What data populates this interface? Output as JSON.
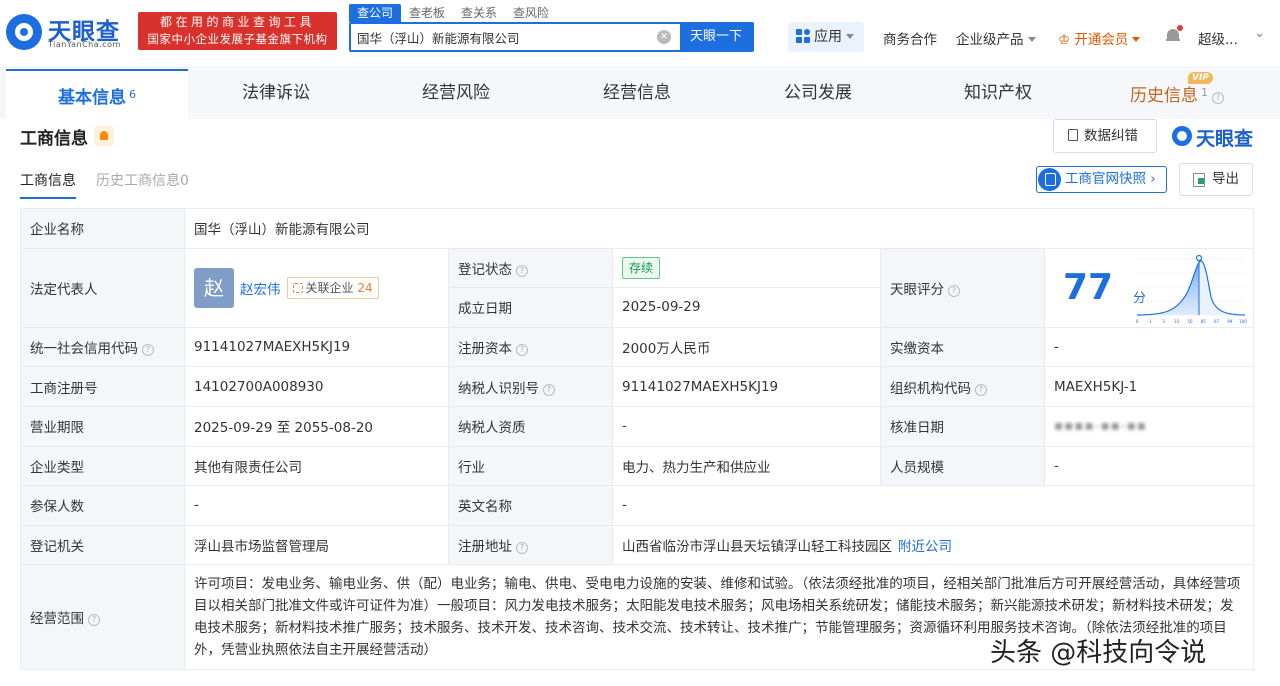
{
  "logo": {
    "title": "天眼查",
    "subtitle": "TianYanCha.com"
  },
  "slogan": {
    "line1": "都在用的商业查询工具",
    "line2": "国家中小企业发展子基金旗下机构"
  },
  "search": {
    "tabs": [
      "查公司",
      "查老板",
      "查关系",
      "查风险"
    ],
    "value": "国华（浮山）新能源有限公司",
    "button": "天眼一下"
  },
  "nav": {
    "apps": "应用",
    "business": "商务合作",
    "enterprise": "企业级产品",
    "vip": "开通会员",
    "user": "超级..."
  },
  "main_tabs": {
    "basic": "基本信息",
    "basic_count": "6",
    "legal": "法律诉讼",
    "risk": "经营风险",
    "operation": "经营信息",
    "development": "公司发展",
    "ip": "知识产权",
    "history": "历史信息",
    "history_count": "1",
    "vip_badge": "VIP"
  },
  "section": {
    "title": "工商信息",
    "correct": "数据纠错",
    "brand": "天眼查",
    "sub_tab_active": "工商信息",
    "sub_tab_history": "历史工商信息0",
    "snapshot": "工商官网快照",
    "export": "导出"
  },
  "table": {
    "company_name_label": "企业名称",
    "company_name": "国华（浮山）新能源有限公司",
    "legal_rep_label": "法定代表人",
    "legal_rep_avatar": "赵",
    "legal_rep": "赵宏伟",
    "related_label": "关联企业",
    "related_count": "24",
    "reg_status_label": "登记状态",
    "reg_status": "存续",
    "founded_label": "成立日期",
    "founded": "2025-09-29",
    "score_label": "天眼评分",
    "score": "77",
    "score_unit": "分",
    "credit_code_label": "统一社会信用代码",
    "credit_code": "91141027MAEXH5KJ19",
    "reg_capital_label": "注册资本",
    "reg_capital": "2000万人民币",
    "paid_capital_label": "实缴资本",
    "paid_capital": "-",
    "reg_no_label": "工商注册号",
    "reg_no": "14102700A008930",
    "tax_id_label": "纳税人识别号",
    "tax_id": "91141027MAEXH5KJ19",
    "org_code_label": "组织机构代码",
    "org_code": "MAEXH5KJ-1",
    "term_label": "营业期限",
    "term": "2025-09-29 至 2055-08-20",
    "tax_qual_label": "纳税人资质",
    "tax_qual": "-",
    "approval_label": "核准日期",
    "type_label": "企业类型",
    "type": "其他有限责任公司",
    "industry_label": "行业",
    "industry": "电力、热力生产和供应业",
    "staff_label": "人员规模",
    "staff": "-",
    "insured_label": "参保人数",
    "insured": "-",
    "english_label": "英文名称",
    "english": "-",
    "authority_label": "登记机关",
    "authority": "浮山县市场监督管理局",
    "address_label": "注册地址",
    "address": "山西省临汾市浮山县天坛镇浮山轻工科技园区",
    "nearby": "附近公司",
    "scope_label": "经营范围",
    "scope": "许可项目：发电业务、输电业务、供（配）电业务；输电、供电、受电电力设施的安装、维修和试验。（依法须经批准的项目，经相关部门批准后方可开展经营活动，具体经营项目以相关部门批准文件或许可证件为准）一般项目：风力发电技术服务；太阳能发电技术服务；风电场相关系统研发；储能技术服务；新兴能源技术研发；新材料技术研发；发电技术服务；新材料技术推广服务；技术服务、技术开发、技术咨询、技术交流、技术转让、技术推广；节能管理服务；资源循环利用服务技术咨询。（除依法须经批准的项目外，凭营业执照依法自主开展经营活动）"
  },
  "score_chart_ticks": [
    "0",
    "1",
    "3",
    "15",
    "50",
    "85",
    "97",
    "99",
    "100"
  ],
  "watermark": "头条 @科技向令说",
  "colors": {
    "brand_blue": "#1d6fe0",
    "slogan_red": "#d9312b",
    "vip_orange": "#e05a00",
    "status_green": "#189a50"
  }
}
